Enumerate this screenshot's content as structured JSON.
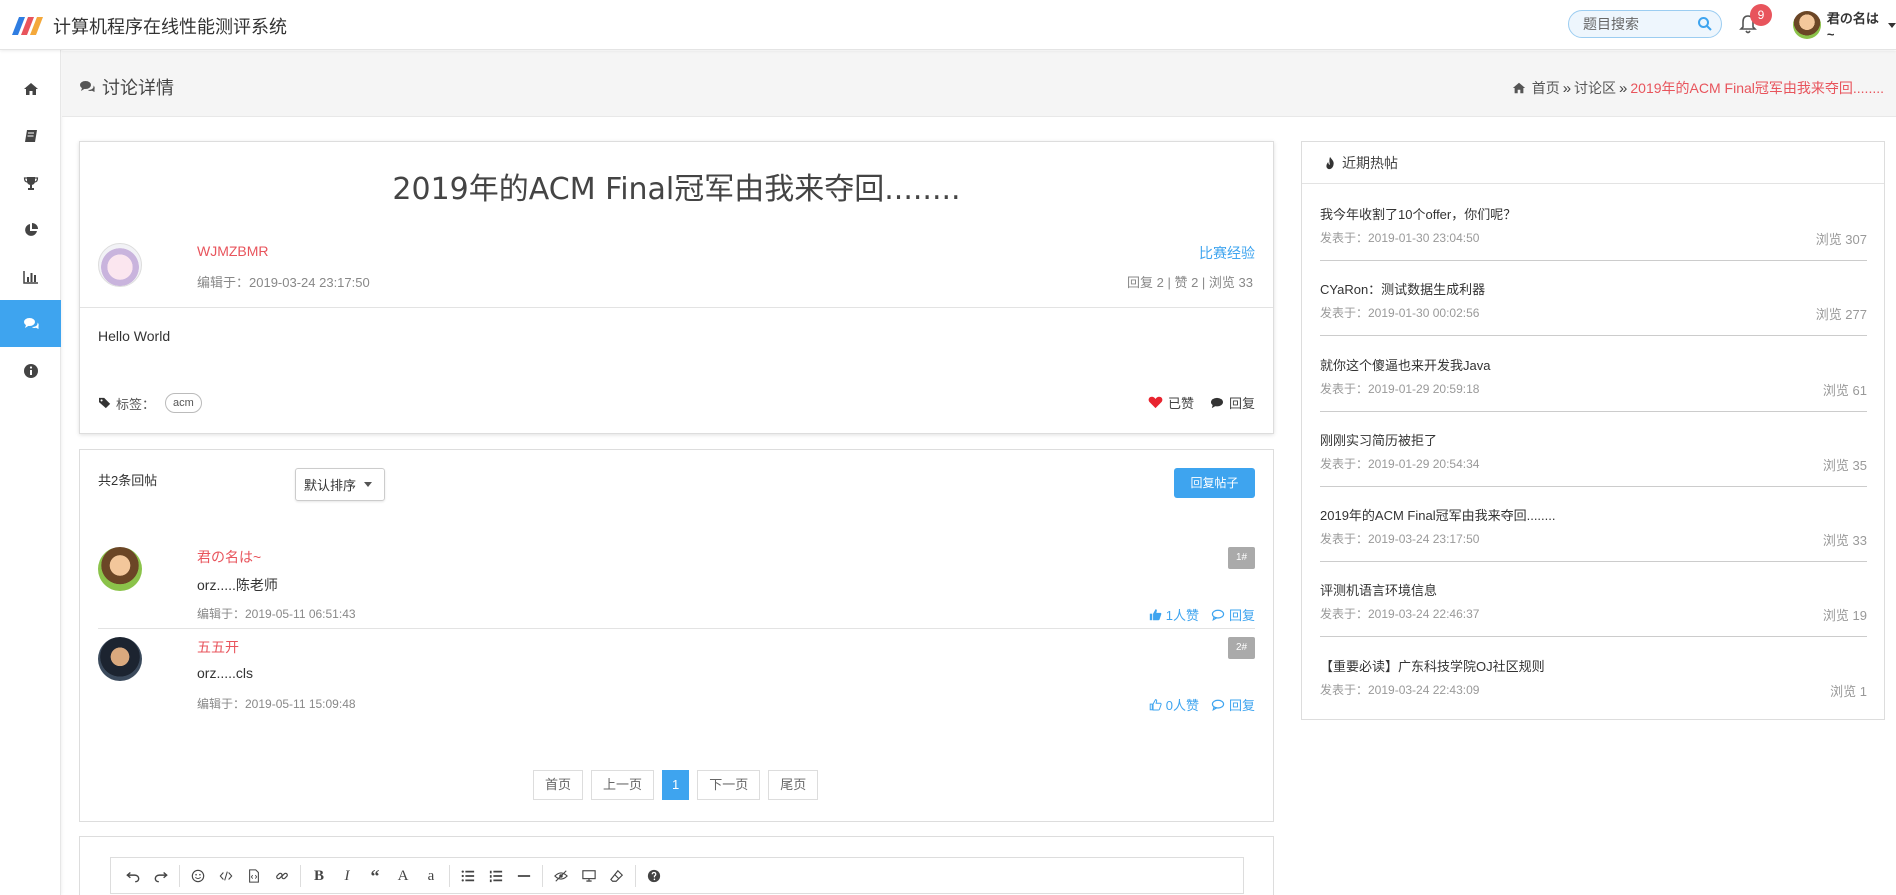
{
  "app": {
    "title": "计算机程序在线性能测评系统"
  },
  "header": {
    "search_placeholder": "题目搜索",
    "notifications": "9",
    "user_name": "君の名は~"
  },
  "nav": [
    "home-icon",
    "book-icon",
    "trophy-icon",
    "pie-chart-icon",
    "bar-chart-icon",
    "comments-icon",
    "info-icon"
  ],
  "page": {
    "title": "讨论详情",
    "breadcrumb": {
      "home": "首页",
      "section": "讨论区",
      "current": "2019年的ACM Final冠军由我来夺回........"
    }
  },
  "post": {
    "title": "2019年的ACM Final冠军由我来夺回........",
    "author": "WJMZBMR",
    "edited": "编辑于：2019-03-24 23:17:50",
    "category": "比赛经验",
    "stats": "回复 2 | 赞 2 | 浏览 33",
    "body": "Hello World",
    "tags_label": "标签：",
    "tags": [
      "acm"
    ],
    "liked_label": "已赞",
    "reply_label": "回复"
  },
  "replies": {
    "count_label": "共2条回帖",
    "sort_label": "默认排序",
    "reply_button": "回复帖子",
    "items": [
      {
        "author": "君の名は~",
        "content": "orz.....陈老师",
        "time": "编辑于：2019-05-11 06:51:43",
        "floor": "1#",
        "likes": "1人赞",
        "reply": "回复"
      },
      {
        "author": "五五开",
        "content": "orz.....cls",
        "time": "编辑于：2019-05-11 15:09:48",
        "floor": "2#",
        "likes": "0人赞",
        "reply": "回复"
      }
    ],
    "pager": {
      "first": "首页",
      "prev": "上一页",
      "current": "1",
      "next": "下一页",
      "last": "尾页"
    }
  },
  "editor": {
    "tools": [
      "undo-icon",
      "redo-icon",
      "emoji-icon",
      "code-icon",
      "code-block-icon",
      "link-icon",
      "bold-icon",
      "italic-icon",
      "quote-icon",
      "uppercase-icon",
      "lowercase-icon",
      "unordered-list-icon",
      "ordered-list-icon",
      "hr-icon",
      "preview-icon",
      "fullscreen-icon",
      "clear-icon",
      "help-icon"
    ]
  },
  "hot": {
    "title": "近期热帖",
    "items": [
      {
        "title": "我今年收割了10个offer，你们呢？",
        "time": "发表于：2019-01-30 23:04:50",
        "views": "浏览 307"
      },
      {
        "title": "CYaRon：测试数据生成利器",
        "time": "发表于：2019-01-30 00:02:56",
        "views": "浏览 277"
      },
      {
        "title": "就你这个傻逼也来开发我Java",
        "time": "发表于：2019-01-29 20:59:18",
        "views": "浏览 61"
      },
      {
        "title": "刚刚实习简历被拒了",
        "time": "发表于：2019-01-29 20:54:34",
        "views": "浏览 35"
      },
      {
        "title": "2019年的ACM Final冠军由我来夺回........",
        "time": "发表于：2019-03-24 23:17:50",
        "views": "浏览 33"
      },
      {
        "title": "评测机语言环境信息",
        "time": "发表于：2019-03-24 22:46:37",
        "views": "浏览 19"
      },
      {
        "title": "【重要必读】广东科技学院OJ社区规则",
        "time": "发表于：2019-03-24 22:43:09",
        "views": "浏览 1"
      }
    ]
  },
  "colors": {
    "accent": "#3ea4ef",
    "author": "#e8545c",
    "badge": "#e8545c"
  }
}
